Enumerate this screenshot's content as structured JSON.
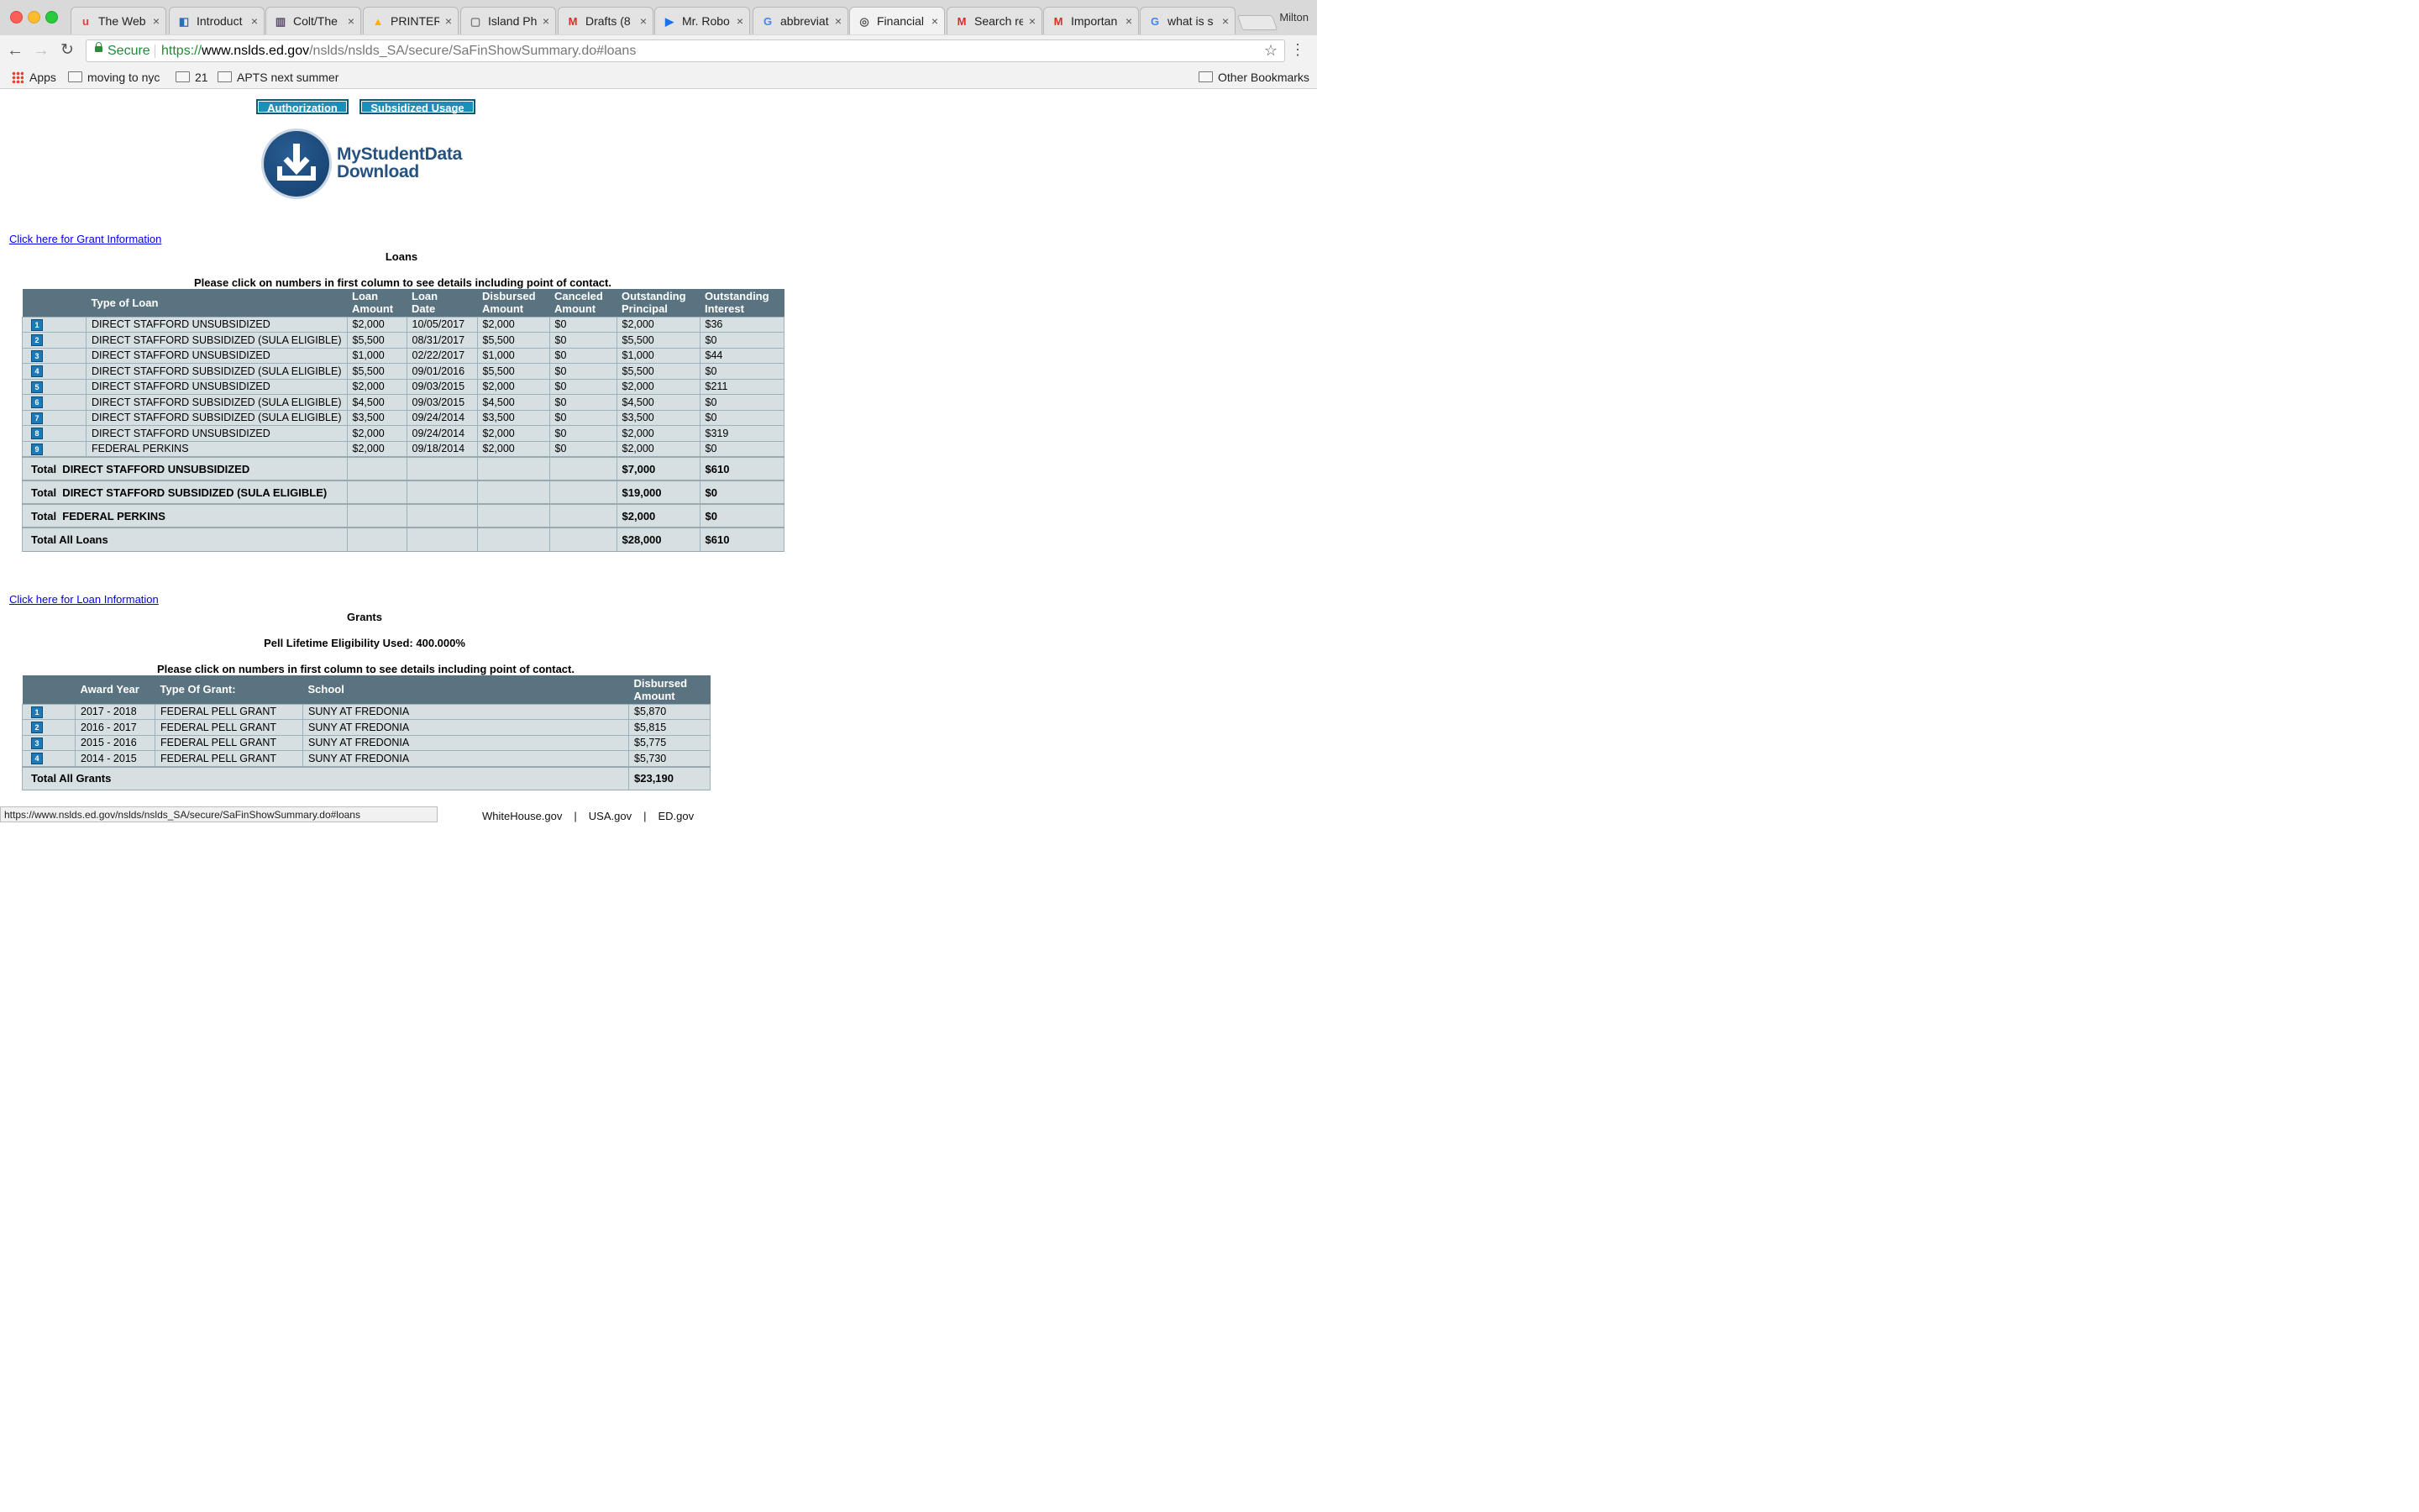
{
  "browser": {
    "tabs": [
      {
        "title": "The Web",
        "favicon": "u-icon",
        "fav_char": "u",
        "fav_color": "#e3413b"
      },
      {
        "title": "Introduct",
        "favicon": "doc-icon",
        "fav_char": "◧",
        "fav_color": "#2d6fb6"
      },
      {
        "title": "Colt/The",
        "favicon": "box-icon",
        "fav_char": "▥",
        "fav_color": "#5b4a6a"
      },
      {
        "title": "PRINTER",
        "favicon": "drive-icon",
        "fav_char": "▲",
        "fav_color": "#f4b400"
      },
      {
        "title": "Island Ph",
        "favicon": "page-icon",
        "fav_char": "▢",
        "fav_color": "#777777"
      },
      {
        "title": "Drafts (8",
        "favicon": "gmail-icon",
        "fav_char": "M",
        "fav_color": "#d93025"
      },
      {
        "title": "Mr. Robo",
        "favicon": "play-icon",
        "fav_char": "▶",
        "fav_color": "#1a73e8"
      },
      {
        "title": "abbreviat",
        "favicon": "google-icon",
        "fav_char": "G",
        "fav_color": "#4285f4"
      },
      {
        "title": "Financial",
        "favicon": "seal-icon",
        "fav_char": "◎",
        "fav_color": "#555555",
        "active": true
      },
      {
        "title": "Search re",
        "favicon": "gmail-icon",
        "fav_char": "M",
        "fav_color": "#d93025"
      },
      {
        "title": "Importan",
        "favicon": "gmail-icon",
        "fav_char": "M",
        "fav_color": "#d93025"
      },
      {
        "title": "what is s",
        "favicon": "google-icon",
        "fav_char": "G",
        "fav_color": "#4285f4"
      }
    ],
    "profile_name": "Milton",
    "secure_label": "Secure",
    "url_proto": "https://",
    "url_host": "www.nslds.ed.gov",
    "url_path": "/nslds/nslds_SA/secure/SaFinShowSummary.do#loans",
    "bookmarks": [
      "Apps",
      "moving to nyc",
      "21",
      "APTS next summer"
    ],
    "other_bookmarks": "Other Bookmarks",
    "status_url": "https://www.nslds.ed.gov/nslds/nslds_SA/secure/SaFinShowSummary.do#loans"
  },
  "page": {
    "buttons": {
      "authorization": "Authorization",
      "subsidized_usage": "Subsidized Usage"
    },
    "logo": {
      "line1": "MyStudentData",
      "line2": "Download"
    },
    "grant_link": "Click here for Grant Information",
    "loans_title": "Loans",
    "loans_instruction": "Please click on numbers in first column to see details including point of contact.",
    "loan_headers": {
      "type": "Type of Loan",
      "amount": [
        "Loan",
        "Amount"
      ],
      "date": [
        "Loan",
        "Date"
      ],
      "disbursed": [
        "Disbursed",
        "Amount"
      ],
      "canceled": [
        "Canceled",
        "Amount"
      ],
      "principal": [
        "Outstanding",
        "Principal"
      ],
      "interest": [
        "Outstanding",
        "Interest"
      ]
    },
    "loans": [
      {
        "n": "1",
        "type": "DIRECT STAFFORD UNSUBSIDIZED",
        "amount": "$2,000",
        "date": "10/05/2017",
        "disbursed": "$2,000",
        "canceled": "$0",
        "principal": "$2,000",
        "interest": "$36"
      },
      {
        "n": "2",
        "type": "DIRECT STAFFORD SUBSIDIZED (SULA ELIGIBLE)",
        "amount": "$5,500",
        "date": "08/31/2017",
        "disbursed": "$5,500",
        "canceled": "$0",
        "principal": "$5,500",
        "interest": "$0"
      },
      {
        "n": "3",
        "type": "DIRECT STAFFORD UNSUBSIDIZED",
        "amount": "$1,000",
        "date": "02/22/2017",
        "disbursed": "$1,000",
        "canceled": "$0",
        "principal": "$1,000",
        "interest": "$44"
      },
      {
        "n": "4",
        "type": "DIRECT STAFFORD SUBSIDIZED (SULA ELIGIBLE)",
        "amount": "$5,500",
        "date": "09/01/2016",
        "disbursed": "$5,500",
        "canceled": "$0",
        "principal": "$5,500",
        "interest": "$0"
      },
      {
        "n": "5",
        "type": "DIRECT STAFFORD UNSUBSIDIZED",
        "amount": "$2,000",
        "date": "09/03/2015",
        "disbursed": "$2,000",
        "canceled": "$0",
        "principal": "$2,000",
        "interest": "$211"
      },
      {
        "n": "6",
        "type": "DIRECT STAFFORD SUBSIDIZED (SULA ELIGIBLE)",
        "amount": "$4,500",
        "date": "09/03/2015",
        "disbursed": "$4,500",
        "canceled": "$0",
        "principal": "$4,500",
        "interest": "$0"
      },
      {
        "n": "7",
        "type": "DIRECT STAFFORD SUBSIDIZED (SULA ELIGIBLE)",
        "amount": "$3,500",
        "date": "09/24/2014",
        "disbursed": "$3,500",
        "canceled": "$0",
        "principal": "$3,500",
        "interest": "$0"
      },
      {
        "n": "8",
        "type": "DIRECT STAFFORD UNSUBSIDIZED",
        "amount": "$2,000",
        "date": "09/24/2014",
        "disbursed": "$2,000",
        "canceled": "$0",
        "principal": "$2,000",
        "interest": "$319"
      },
      {
        "n": "9",
        "type": "FEDERAL PERKINS",
        "amount": "$2,000",
        "date": "09/18/2014",
        "disbursed": "$2,000",
        "canceled": "$0",
        "principal": "$2,000",
        "interest": "$0"
      }
    ],
    "loan_totals": [
      {
        "label": "Total  DIRECT STAFFORD UNSUBSIDIZED",
        "principal": "$7,000",
        "interest": "$610"
      },
      {
        "label": "Total  DIRECT STAFFORD SUBSIDIZED (SULA ELIGIBLE)",
        "principal": "$19,000",
        "interest": "$0"
      },
      {
        "label": "Total  FEDERAL PERKINS",
        "principal": "$2,000",
        "interest": "$0"
      },
      {
        "label": "Total All Loans",
        "principal": "$28,000",
        "interest": "$610"
      }
    ],
    "loan_link": "Click here for Loan Information",
    "grants_title": "Grants",
    "pell_text": "Pell Lifetime Eligibility Used: 400.000%",
    "grants_instruction": "Please click on numbers in first column to see details including point of contact.",
    "grant_headers": {
      "year": "Award Year",
      "type": "Type Of Grant:",
      "school": "School",
      "disbursed": [
        "Disbursed",
        "Amount"
      ]
    },
    "grants": [
      {
        "n": "1",
        "year": "2017 - 2018",
        "type": "FEDERAL PELL GRANT",
        "school": "SUNY AT FREDONIA",
        "disbursed": "$5,870"
      },
      {
        "n": "2",
        "year": "2016 - 2017",
        "type": "FEDERAL PELL GRANT",
        "school": "SUNY AT FREDONIA",
        "disbursed": "$5,815"
      },
      {
        "n": "3",
        "year": "2015 - 2016",
        "type": "FEDERAL PELL GRANT",
        "school": "SUNY AT FREDONIA",
        "disbursed": "$5,775"
      },
      {
        "n": "4",
        "year": "2014 - 2015",
        "type": "FEDERAL PELL GRANT",
        "school": "SUNY AT FREDONIA",
        "disbursed": "$5,730"
      }
    ],
    "grant_total": {
      "label": "Total All Grants",
      "disbursed": "$23,190"
    },
    "footer": [
      "WhiteHouse.gov",
      "USA.gov",
      "ED.gov"
    ]
  }
}
